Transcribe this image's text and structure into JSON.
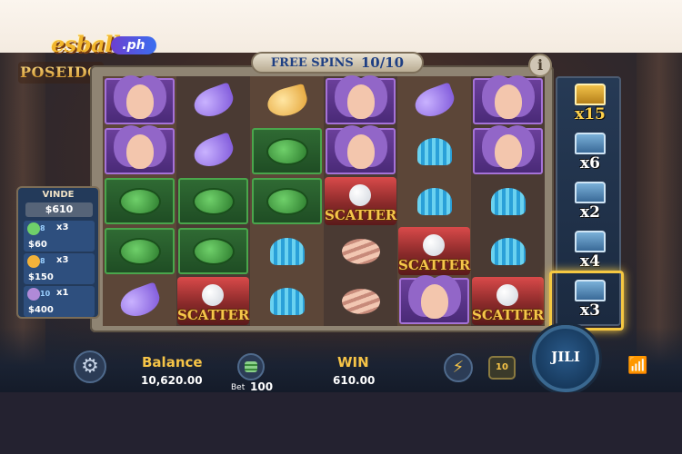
{
  "branding": {
    "site_text": "esball",
    "site_suffix": ".ph",
    "game_logo": "POSEIDON"
  },
  "free_spins": {
    "label": "FREE SPINS",
    "count": "10/10"
  },
  "info_button": {
    "label": "i"
  },
  "reels": [
    [
      "mermaid",
      "mermaid",
      "turtle",
      "turtle",
      "shell-purple"
    ],
    [
      "shell-purple",
      "shell-purple",
      "turtle",
      "turtle",
      "scatter"
    ],
    [
      "shell-gold",
      "turtle",
      "turtle",
      "shell-blue",
      "shell-blue"
    ],
    [
      "mermaid",
      "mermaid",
      "scatter",
      "shell-pink",
      "shell-pink"
    ],
    [
      "shell-purple",
      "shell-blue",
      "shell-blue",
      "scatter",
      "mermaid"
    ],
    [
      "mermaid",
      "mermaid",
      "shell-blue",
      "shell-blue",
      "scatter"
    ]
  ],
  "scatter_label": "SCATTER",
  "multipliers": [
    {
      "label": "x15",
      "type": "gold"
    },
    {
      "label": "x6",
      "type": "silver"
    },
    {
      "label": "x2",
      "type": "silver"
    },
    {
      "label": "x4",
      "type": "silver"
    },
    {
      "label": "x3",
      "type": "silver",
      "highlighted": true
    }
  ],
  "paytable": {
    "title": "VINDE",
    "total": "$610",
    "rows": [
      {
        "count": "8",
        "mult": "x3",
        "value": "$60",
        "icon_color": "#6fd06a"
      },
      {
        "count": "8",
        "mult": "x3",
        "value": "$150",
        "icon_color": "#f2b23a"
      },
      {
        "count": "10",
        "mult": "x1",
        "value": "$400",
        "icon_color": "#b08ad8"
      }
    ]
  },
  "bottom_bar": {
    "balance_label": "Balance",
    "balance_value": "10,620.00",
    "bet_label": "Bet",
    "bet_value": "100",
    "win_label": "WIN",
    "win_value": "610.00",
    "auto_label": "10",
    "spin_label": "JILI"
  },
  "icons": {
    "settings": "gear-icon",
    "bet": "chip-stack-icon",
    "turbo": "lightning-icon",
    "signal": "wifi-icon"
  }
}
